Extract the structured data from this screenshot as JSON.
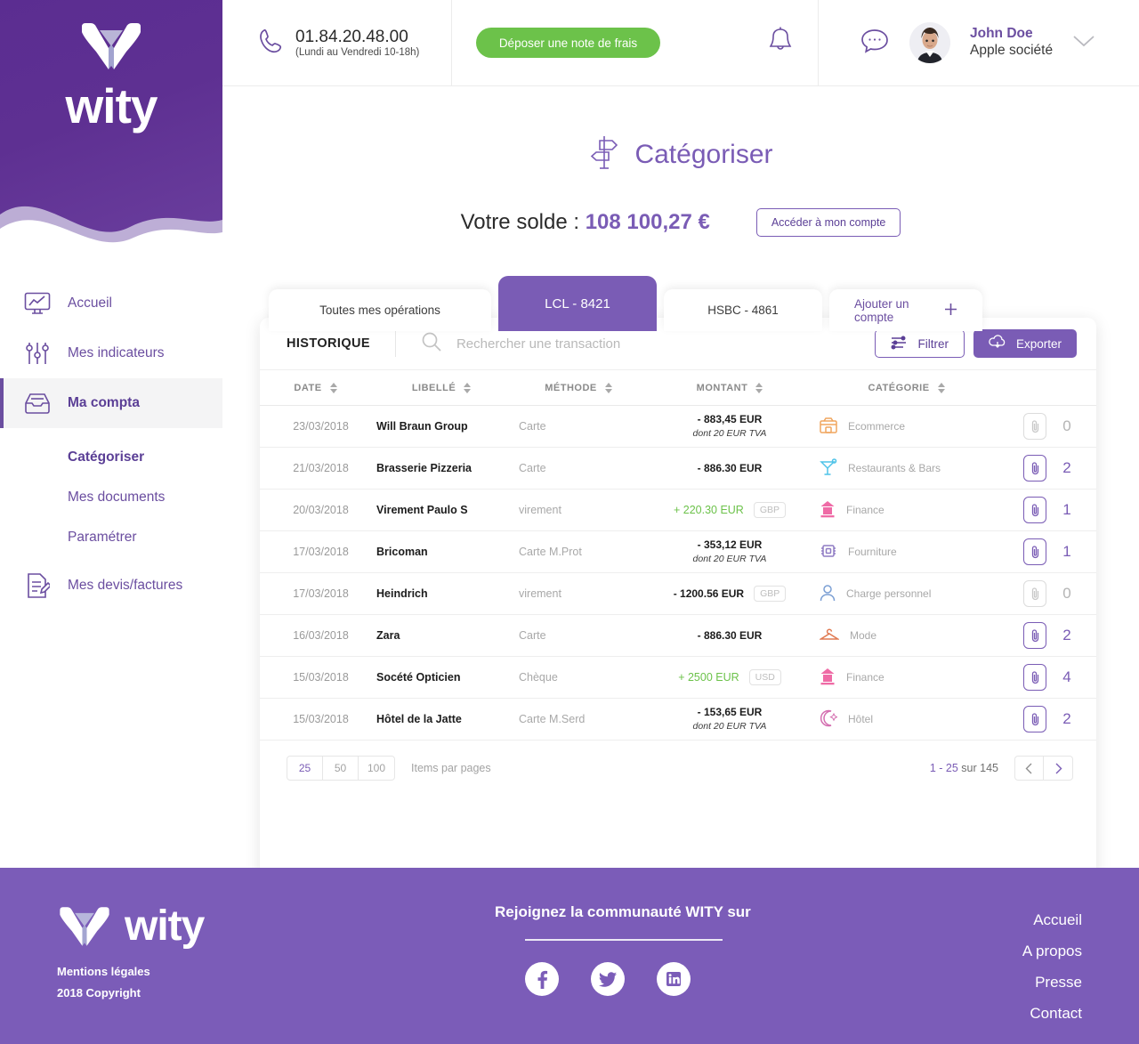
{
  "brand": {
    "name": "wity"
  },
  "sidebar": {
    "items": [
      {
        "label": "Accueil",
        "icon": "chart-monitor-icon"
      },
      {
        "label": "Mes indicateurs",
        "icon": "sliders-icon"
      },
      {
        "label": "Ma compta",
        "icon": "inbox-tray-icon",
        "active": true
      },
      {
        "label": "Mes devis/factures",
        "icon": "document-edit-icon"
      }
    ],
    "subitems": [
      {
        "label": "Catégoriser",
        "current": true
      },
      {
        "label": "Mes documents",
        "current": false
      },
      {
        "label": "Paramétrer",
        "current": false
      }
    ]
  },
  "header": {
    "phone_number": "01.84.20.48.00",
    "phone_hours": "(Lundi au Vendredi 10-18h)",
    "cta_label": "Déposer une note de frais",
    "user_name": "John Doe",
    "user_org": "Apple société"
  },
  "page": {
    "title": "Catégoriser",
    "balance_label": "Votre solde :",
    "balance_value": "108 100,27 €",
    "account_button": "Accéder à mon compte"
  },
  "tabs": [
    {
      "label": "Toutes mes opérations",
      "active": false
    },
    {
      "label": "LCL - 8421",
      "active": true
    },
    {
      "label": "HSBC - 4861",
      "active": false
    },
    {
      "label": "Ajouter un compte",
      "active": false,
      "add": true
    }
  ],
  "card": {
    "history_title": "HISTORIQUE",
    "search_placeholder": "Rechercher une transaction",
    "search_value": "",
    "filter_label": "Filtrer",
    "export_label": "Exporter"
  },
  "table": {
    "columns": [
      "DATE",
      "LIBELLÉ",
      "MÉTHODE",
      "MONTANT",
      "CATÉGORIE"
    ],
    "rows": [
      {
        "date": "23/03/2018",
        "label": "Will Braun Group",
        "method": "Carte",
        "amount": "- 883,45 EUR",
        "positive": false,
        "tva": "dont 20 EUR TVA",
        "currency": "",
        "category": "Ecommerce",
        "cat_icon": "shop-icon",
        "cat_color": "#f0a55e",
        "attachments": "0"
      },
      {
        "date": "21/03/2018",
        "label": "Brasserie Pizzeria",
        "method": "Carte",
        "amount": "- 886.30 EUR",
        "positive": false,
        "tva": "",
        "currency": "",
        "category": "Restaurants & Bars",
        "cat_icon": "cocktail-icon",
        "cat_color": "#4fc3e8",
        "attachments": "2"
      },
      {
        "date": "20/03/2018",
        "label": "Virement Paulo S",
        "method": "virement",
        "amount": "+ 220.30 EUR",
        "positive": true,
        "tva": "",
        "currency": "GBP",
        "category": "Finance",
        "cat_icon": "bank-icon",
        "cat_color": "#ef6ba6",
        "attachments": "1"
      },
      {
        "date": "17/03/2018",
        "label": "Bricoman",
        "method": "Carte M.Prot",
        "amount": "- 353,12 EUR",
        "positive": false,
        "tva": "dont 20 EUR TVA",
        "currency": "",
        "category": "Fourniture",
        "cat_icon": "chip-icon",
        "cat_color": "#8f7bc4",
        "attachments": "1"
      },
      {
        "date": "17/03/2018",
        "label": "Heindrich",
        "method": "virement",
        "amount": "- 1200.56 EUR",
        "positive": false,
        "tva": "",
        "currency": "GBP",
        "category": "Charge personnel",
        "cat_icon": "person-icon",
        "cat_color": "#7b9fd4",
        "attachments": "0"
      },
      {
        "date": "16/03/2018",
        "label": "Zara",
        "method": "Carte",
        "amount": "- 886.30 EUR",
        "positive": false,
        "tva": "",
        "currency": "",
        "category": "Mode",
        "cat_icon": "hanger-icon",
        "cat_color": "#e07a52",
        "attachments": "2"
      },
      {
        "date": "15/03/2018",
        "label": "Socété Opticien",
        "method": "Chèque",
        "amount": "+ 2500 EUR",
        "positive": true,
        "tva": "",
        "currency": "USD",
        "category": "Finance",
        "cat_icon": "bank-icon",
        "cat_color": "#ef6ba6",
        "attachments": "4"
      },
      {
        "date": "15/03/2018",
        "label": "Hôtel de la Jatte",
        "method": "Carte M.Serd",
        "amount": "- 153,65 EUR",
        "positive": false,
        "tva": "dont 20 EUR TVA",
        "currency": "",
        "category": "Hôtel",
        "cat_icon": "moon-icon",
        "cat_color": "#d46fb0",
        "attachments": "2"
      }
    ]
  },
  "pagination": {
    "sizes": [
      "25",
      "50",
      "100"
    ],
    "selected_size": "25",
    "items_label": "Items par pages",
    "range_current": "1 - 25",
    "range_total": " sur 145"
  },
  "footer": {
    "logo_word": "wity",
    "legal_1": "Mentions légales",
    "legal_2": "2018 Copyright",
    "community_title": "Rejoignez la communauté WITY sur",
    "socials": [
      "facebook-icon",
      "twitter-icon",
      "linkedin-icon"
    ],
    "links": [
      "Accueil",
      "A propos",
      "Presse",
      "Contact"
    ]
  },
  "colors": {
    "brand_purple": "#5b2d91",
    "accent_purple": "#7a5cb5",
    "green": "#6cc24a",
    "footer_purple": "#7b5cb8"
  }
}
